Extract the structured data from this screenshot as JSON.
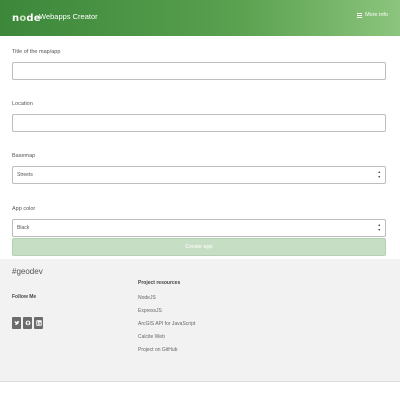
{
  "header": {
    "logo_text": "node",
    "title": "Webapps Creator",
    "more_info": "More info",
    "menu_icon": "hamburger-icon"
  },
  "form": {
    "title_field": {
      "label": "Title of the map/app",
      "value": "",
      "placeholder": ""
    },
    "location_field": {
      "label": "Location",
      "value": "",
      "placeholder": ""
    },
    "basemap": {
      "label": "Basemap",
      "selected": "Streets"
    },
    "app_color": {
      "label": "App color",
      "selected": "Black"
    },
    "create_button": "Create app"
  },
  "footer": {
    "brand": "#geodev",
    "follow_label": "Follow Me",
    "social_icons": [
      "twitter-icon",
      "github-icon",
      "linkedin-icon"
    ],
    "resources_title": "Project resources",
    "resources": [
      "NodeJS",
      "ExpressJS",
      "ArcGIS API for JavaScript",
      "Calcite Web",
      "Project on GitHub"
    ]
  },
  "colors": {
    "header_start": "#3c873a",
    "header_end": "#8cc57d",
    "button_bg": "#c6dec4",
    "footer_bg": "#f2f2f2",
    "social_icon_bg": "#6c6c6c"
  }
}
